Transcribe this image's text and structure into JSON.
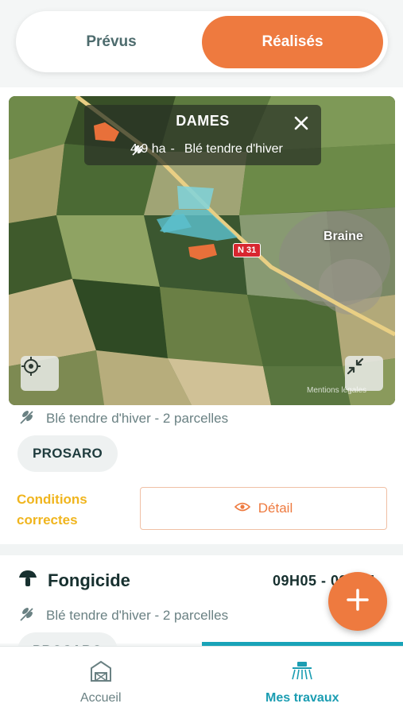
{
  "toggle": {
    "planned_label": "Prévus",
    "done_label": "Réalisés",
    "active": "done"
  },
  "map": {
    "popup": {
      "title": "DAMES",
      "area": "4.9 ha",
      "separator": "-",
      "crop": "Blé tendre d'hiver",
      "close_icon": "close-icon",
      "parcel_icon": "parcel-shape-icon",
      "crop_icon": "wheat-icon"
    },
    "town_label": "Braine",
    "road_label": "N 31",
    "credit": "Mentions légales",
    "locate_icon": "locate-target-icon",
    "collapse_icon": "collapse-arrows-icon"
  },
  "first_work": {
    "crop_line": "Blé tendre d'hiver - 2 parcelles",
    "product": "PROSARO",
    "conditions": "Conditions correctes",
    "detail_label": "Détail",
    "detail_icon": "eye-icon"
  },
  "second_work": {
    "icon": "mushroom-icon",
    "title": "Fongicide",
    "time": "09H05 - 09H05",
    "crop_line": "Blé tendre d'hiver - 2 parcelles",
    "product": "PROSARO"
  },
  "fab": {
    "icon": "plus-icon"
  },
  "bottom_nav": {
    "home_label": "Accueil",
    "home_icon": "farm-icon",
    "works_label": "Mes travaux",
    "works_icon": "sprayer-icon",
    "active": "works"
  },
  "colors": {
    "accent": "#ee7a3f",
    "teal": "#1b9db2",
    "warning": "#f0b51e",
    "text_dark": "#17302f",
    "text_muted": "#6a8183"
  }
}
